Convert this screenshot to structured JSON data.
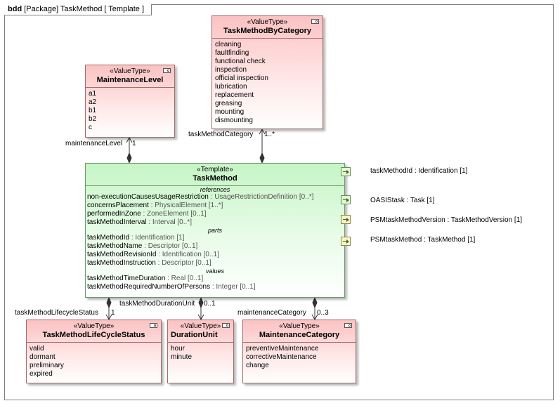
{
  "frame": {
    "kind": "bdd",
    "title": "[Package] TaskMethod [ Template ]"
  },
  "blocks": {
    "task_method_by_category": {
      "stereotype": "«ValueType»",
      "name": "TaskMethodByCategory",
      "literals": [
        "cleaning",
        "faultfinding",
        "functional check",
        "inspection",
        "official inspection",
        "lubrication",
        "replacement",
        "greasing",
        "mounting",
        "dismounting"
      ]
    },
    "maintenance_level": {
      "stereotype": "«ValueType»",
      "name": "MaintenanceLevel",
      "literals": [
        "a1",
        "a2",
        "b1",
        "b2",
        "c"
      ]
    },
    "task_method": {
      "stereotype": "«Template»",
      "name": "TaskMethod",
      "compartments": [
        {
          "title": "references",
          "props": [
            {
              "name": "non-executionCausesUsageRestriction",
              "type": " : UsageRestrictionDefinition [0..*]"
            },
            {
              "name": "concernsPlacement",
              "type": " : PhysicalElement [1..*]"
            },
            {
              "name": "performedInZone",
              "type": " : ZoneElement [0..1]"
            },
            {
              "name": "taskMethodInterval",
              "type": " : Interval [0..*]"
            }
          ]
        },
        {
          "title": "parts",
          "props": [
            {
              "name": "taskMethodId",
              "type": " : Identification [1]"
            },
            {
              "name": "taskMethodName",
              "type": " : Descriptor [0..1]"
            },
            {
              "name": "taskMethodRevisionId",
              "type": " : Identification [0..1]"
            },
            {
              "name": "taskMethodInstruction",
              "type": " : Descriptor [0..1]"
            }
          ]
        },
        {
          "title": "values",
          "props": [
            {
              "name": "taskMethodTimeDuration",
              "type": " : Real [0..1]"
            },
            {
              "name": "taskMethodRequiredNumberOfPersons",
              "type": " : Integer [0..1]"
            }
          ]
        }
      ]
    },
    "lifecycle_status": {
      "stereotype": "«ValueType»",
      "name": "TaskMethodLifeCycleStatus",
      "literals": [
        "valid",
        "dormant",
        "preliminary",
        "expired"
      ]
    },
    "duration_unit": {
      "stereotype": "«ValueType»",
      "name": "DurationUnit",
      "literals": [
        "hour",
        "minute"
      ]
    },
    "maintenance_category": {
      "stereotype": "«ValueType»",
      "name": "MaintenanceCategory",
      "literals": [
        "preventiveMaintenance",
        "correctiveMaintenance",
        "change"
      ]
    }
  },
  "ports": [
    {
      "label": "taskMethodId : Identification [1]",
      "color": "green"
    },
    {
      "label": "OASIStask : Task [1]",
      "color": "green"
    },
    {
      "label": "PSMtaskMethodVersion : TaskMethodVersion [1]",
      "color": "yellow"
    },
    {
      "label": "PSMtaskMethod : TaskMethod [1]",
      "color": "yellow"
    }
  ],
  "associations": {
    "task_method_category": {
      "role": "taskMethodCategory",
      "multiplicity": "1..*"
    },
    "maintenance_level": {
      "role": "maintenanceLevel",
      "multiplicity": "1"
    },
    "lifecycle_status": {
      "role": "taskMethodLifecycleStatus",
      "multiplicity": "1"
    },
    "duration_unit": {
      "role": "taskMethodDurationUnit",
      "multiplicity": "0..1"
    },
    "maintenance_category": {
      "role": "maintenanceCategory",
      "multiplicity": "0..3"
    }
  }
}
